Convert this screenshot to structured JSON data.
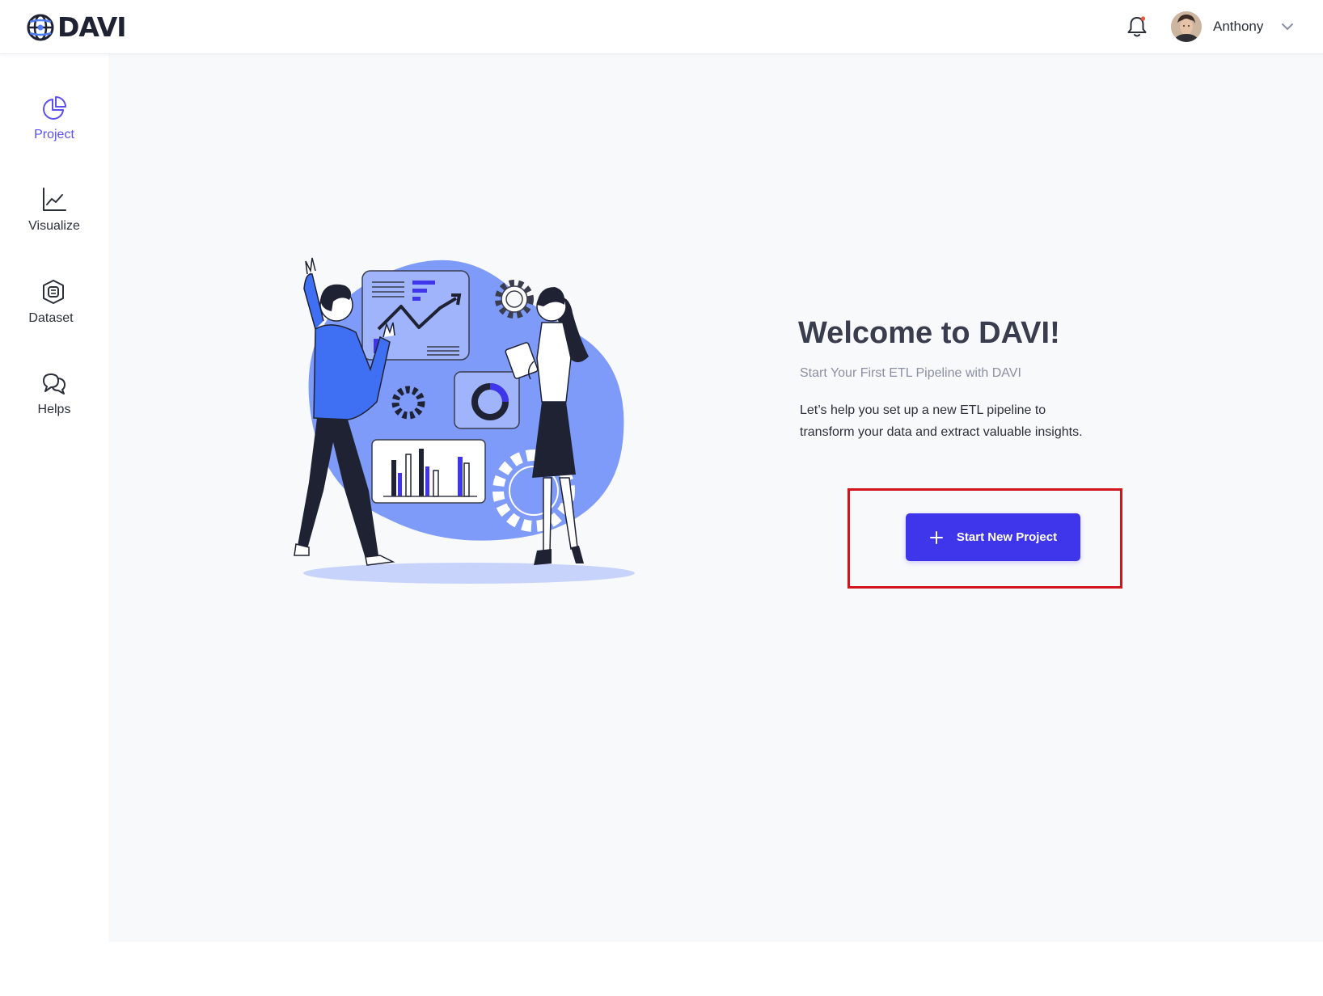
{
  "header": {
    "logo_text": "DAVI",
    "user": {
      "name": "Anthony"
    },
    "icons": {
      "notification": "bell-icon",
      "menu": "chevron-down-icon"
    }
  },
  "sidebar": {
    "items": [
      {
        "label": "Project",
        "icon": "pie-chart-icon",
        "active": true
      },
      {
        "label": "Visualize",
        "icon": "line-chart-icon",
        "active": false
      },
      {
        "label": "Dataset",
        "icon": "database-icon",
        "active": false
      },
      {
        "label": "Helps",
        "icon": "chat-bubbles-icon",
        "active": false
      }
    ]
  },
  "welcome": {
    "title": "Welcome to DAVI!",
    "subtitle": "Start Your First ETL Pipeline with DAVI",
    "description": "Let’s help you set up a new ETL pipeline to transform your data and extract valuable insights.",
    "button_label": "Start New Project"
  },
  "colors": {
    "accent": "#3f35ea",
    "active_nav": "#5b4ff0",
    "illustration_blue": "#7f9bfa",
    "highlight": "#d0161c"
  }
}
